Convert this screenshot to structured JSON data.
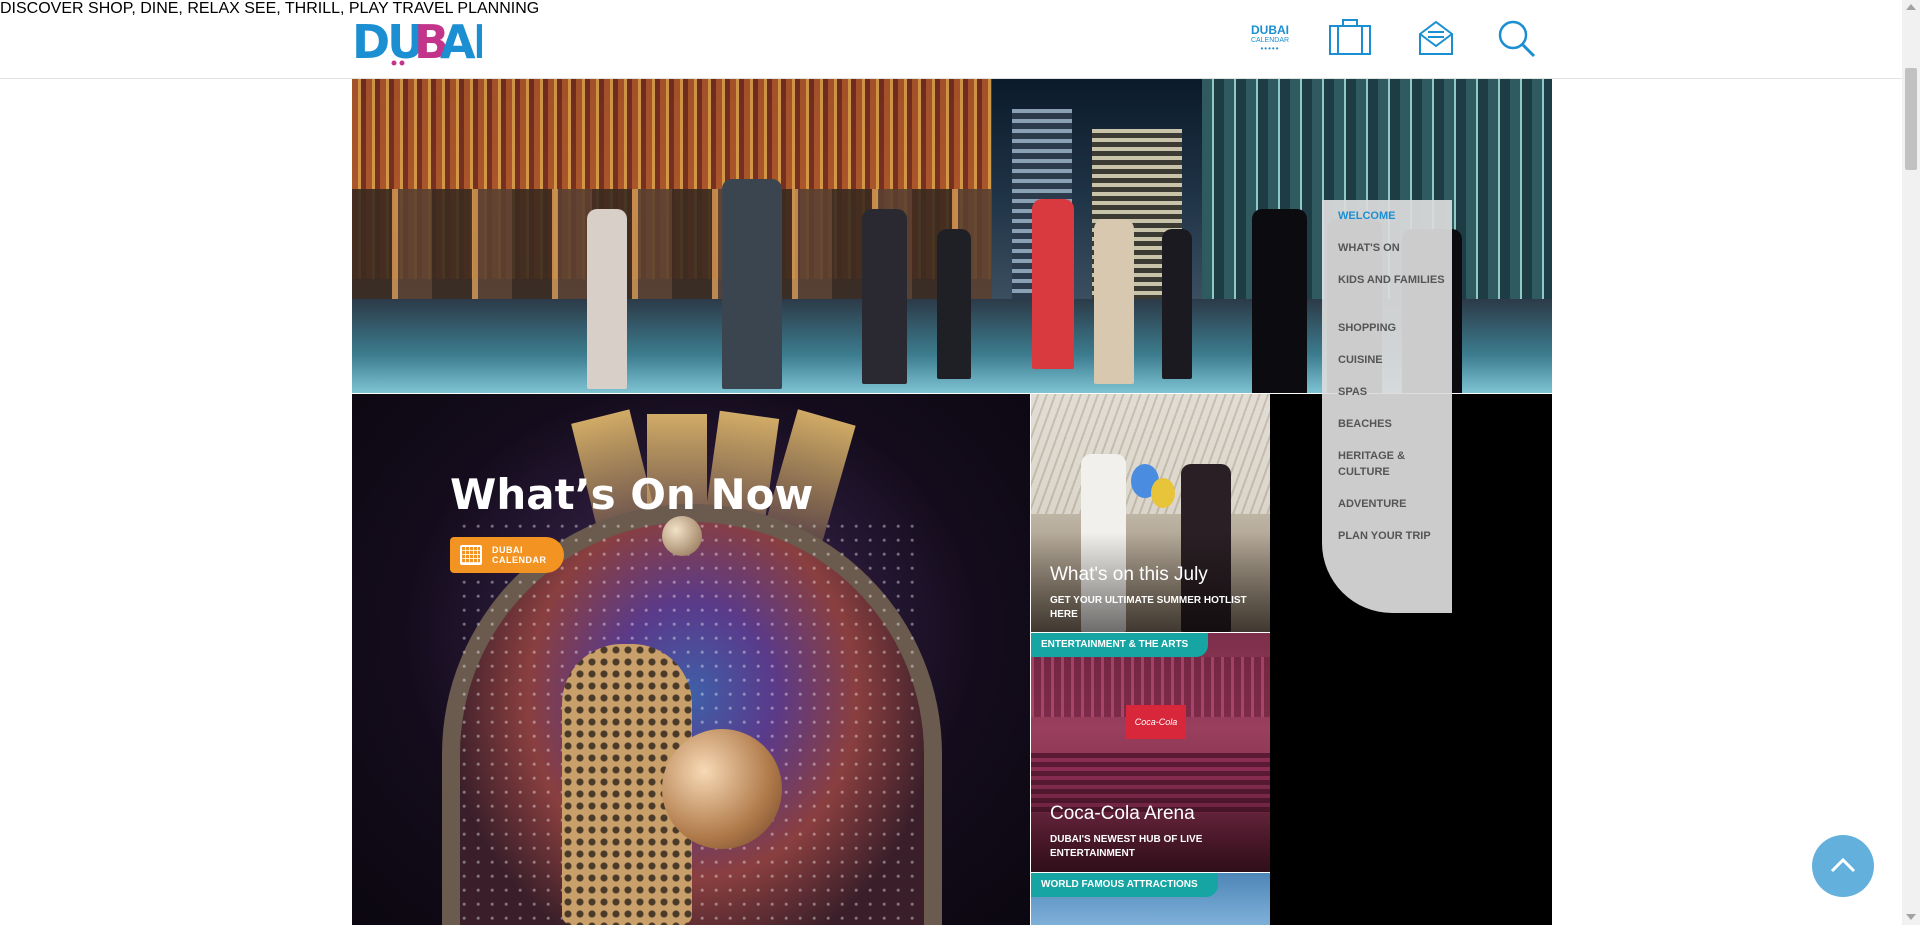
{
  "header": {
    "logo": "DUBAI",
    "nav": [
      {
        "label": "DISCOVER"
      },
      {
        "label": "SHOP, DINE, RELAX"
      },
      {
        "label": "SEE, THRILL, PLAY"
      },
      {
        "label": "TRAVEL PLANNING"
      }
    ],
    "calendar_title": "DUBAI",
    "calendar_sub": "CALENDAR",
    "icons": [
      "suitcase-icon",
      "newsletter-icon",
      "search-icon"
    ]
  },
  "side_menu": [
    {
      "label": "WELCOME",
      "active": true
    },
    {
      "label": "WHAT'S ON"
    },
    {
      "label": "KIDS AND FAMILIES"
    },
    {
      "label": "SHOPPING"
    },
    {
      "label": "CUISINE"
    },
    {
      "label": "SPAS"
    },
    {
      "label": "BEACHES"
    },
    {
      "label": "HERITAGE & CULTURE"
    },
    {
      "label": "ADVENTURE"
    },
    {
      "label": "PLAN YOUR TRIP"
    }
  ],
  "hero": {
    "image": "dubai-night-street-photo"
  },
  "whats_on": {
    "title": "What’s On Now",
    "badge_line1": "DUBAI",
    "badge_line2": "CALENDAR"
  },
  "cards": [
    {
      "title": "What's on this July",
      "subtitle": "GET YOUR ULTIMATE SUMMER HOTLIST HERE"
    },
    {
      "tag": "ENTERTAINMENT & THE ARTS",
      "title": "Coca-Cola Arena",
      "subtitle": "DUBAI'S NEWEST HUB OF LIVE ENTERTAINMENT",
      "screen_text": "Coca-Cola arena"
    },
    {
      "tag": "WORLD FAMOUS ATTRACTIONS"
    }
  ],
  "colors": {
    "brand_blue": "#1b8fd1",
    "brand_magenta": "#c2358b",
    "calendar_orange": "#f39321",
    "tag_teal": "#17a5a3"
  }
}
